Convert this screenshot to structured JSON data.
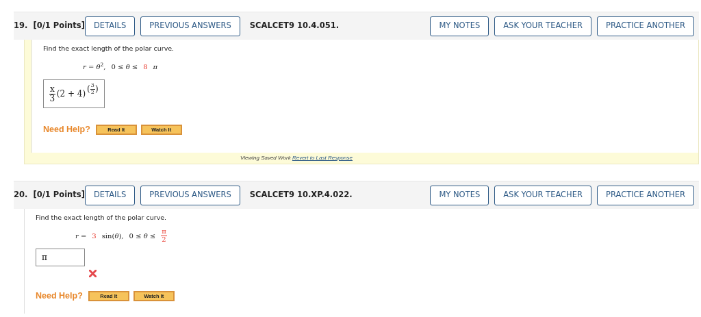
{
  "questions": [
    {
      "number": "19.",
      "points": "[0/1 Points]",
      "buttons_left": [
        "DETAILS",
        "PREVIOUS ANSWERS"
      ],
      "code": "SCALCET9 10.4.051.",
      "buttons_right": [
        "MY NOTES",
        "ASK YOUR TEACHER",
        "PRACTICE ANOTHER"
      ],
      "saved_work": true,
      "prompt": "Find the exact length of the polar curve.",
      "equation": [
        {
          "kind": "text",
          "text": "*r* = *θ*$^{2}$,",
          "red": false
        },
        {
          "kind": "text",
          "text": "0 ≤ *θ* ≤",
          "red": false
        },
        {
          "kind": "text",
          "text": "8",
          "red": true
        },
        {
          "kind": "text",
          "text": "*π*",
          "red": false
        }
      ],
      "answer": {
        "kind": "math",
        "parts": [
          {
            "kind": "frac",
            "num": "x",
            "den": "3"
          },
          {
            "kind": "text",
            "text": "(2 + 4)"
          },
          {
            "kind": "paren_frac",
            "open": "(",
            "num": "3",
            "den": "2",
            "close": ")"
          }
        ]
      },
      "wrong": false,
      "help_label": "Need Help?",
      "help_buttons": [
        "Read It",
        "Watch It"
      ],
      "footer": {
        "text": "Viewing Saved Work",
        "link": "Revert to Last Response"
      }
    },
    {
      "number": "20.",
      "points": "[0/1 Points]",
      "buttons_left": [
        "DETAILS",
        "PREVIOUS ANSWERS"
      ],
      "code": "SCALCET9 10.XP.4.022.",
      "buttons_right": [
        "MY NOTES",
        "ASK YOUR TEACHER",
        "PRACTICE ANOTHER"
      ],
      "saved_work": false,
      "prompt": "Find the exact length of the polar curve.",
      "equation": [
        {
          "kind": "text",
          "text": "*r* =",
          "red": false
        },
        {
          "kind": "text",
          "text": "3",
          "red": true
        },
        {
          "kind": "text",
          "text": "sin(*θ*),",
          "red": false
        },
        {
          "kind": "text",
          "text": "0 ≤ *θ* ≤",
          "red": false
        },
        {
          "kind": "fraction",
          "num": "π",
          "den": "2",
          "red": true
        }
      ],
      "answer": {
        "kind": "field",
        "value": "π"
      },
      "wrong": true,
      "help_label": "Need Help?",
      "help_buttons": [
        "Read It",
        "Watch It"
      ]
    }
  ]
}
